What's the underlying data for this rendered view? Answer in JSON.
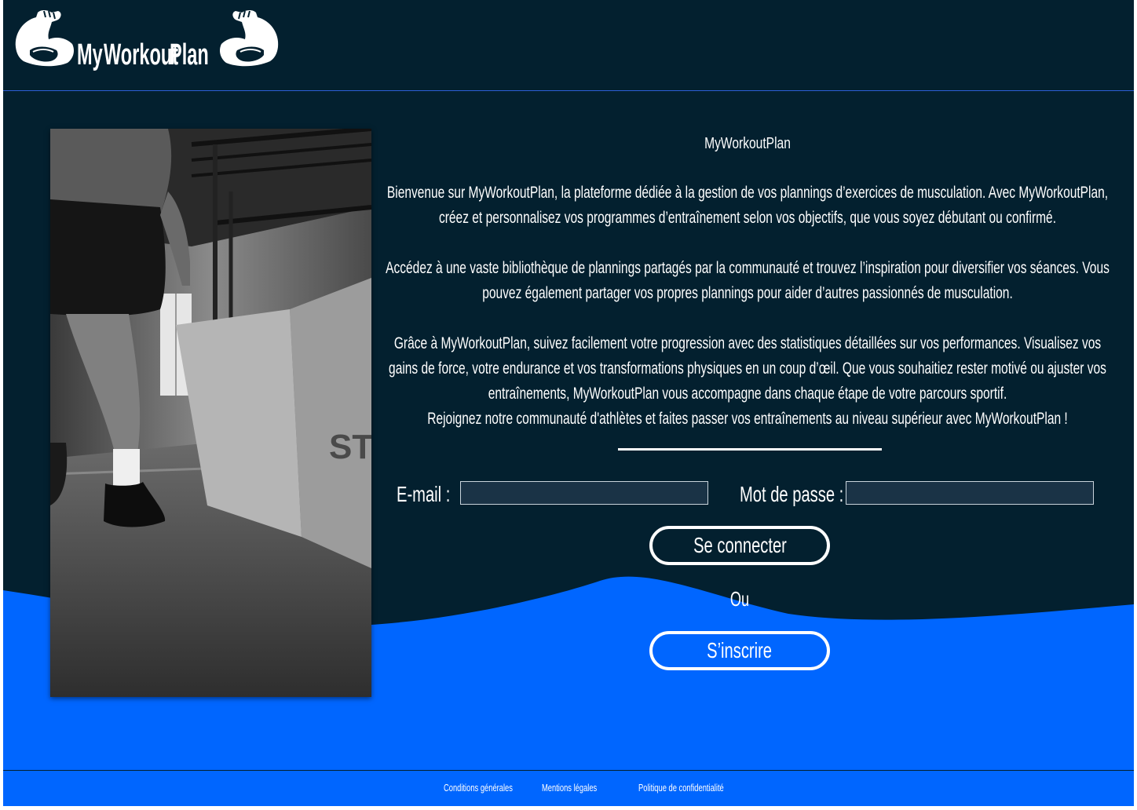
{
  "brand": {
    "logo_words": [
      "My",
      "Workout",
      "Plan"
    ],
    "colors": {
      "navy": "#03202f",
      "blue": "#0066ff",
      "header_rule": "#2d5fd6",
      "input_bg": "#1a3346",
      "text": "#ffffff"
    },
    "icons": [
      "flexed-bicep-left-icon",
      "flexed-bicep-right-icon"
    ]
  },
  "intro": {
    "title": "MyWorkoutPlan",
    "paragraph_1": "Bienvenue sur MyWorkoutPlan, la plateforme dédiée à la gestion de vos plannings d’exercices de musculation. Avec MyWorkoutPlan, créez et personnalisez vos programmes d’entraînement selon vos objectifs, que vous soyez débutant ou confirmé.",
    "paragraph_2": "Accédez à une vaste bibliothèque de plannings partagés par la communauté et trouvez l’inspiration pour diversifier vos séances. Vous pouvez également partager vos propres plannings pour aider d’autres passionnés de musculation.",
    "paragraph_3": "Grâce à MyWorkoutPlan, suivez facilement votre progression avec des statistiques détaillées sur vos performances. Visualisez vos gains de force, votre endurance et vos transformations physiques en un coup d’œil. Que vous souhaitiez rester motivé ou ajuster vos entraînements, MyWorkoutPlan vous accompagne dans chaque étape de votre parcours sportif.",
    "paragraph_4": "Rejoignez notre communauté d'athlètes et faites passer vos entraînements au niveau supérieur avec MyWorkoutPlan !"
  },
  "login": {
    "email_label": "E-mail :",
    "email_value": "",
    "password_label": "Mot de passe :",
    "password_value": "",
    "submit_label": "Se connecter",
    "or_label": "Ou",
    "signup_label": "S’inscrire"
  },
  "hero_image": {
    "box_text": "ST"
  },
  "footer": {
    "links": [
      "Conditions générales",
      "Mentions légales",
      "Politique de confidentialité"
    ]
  }
}
